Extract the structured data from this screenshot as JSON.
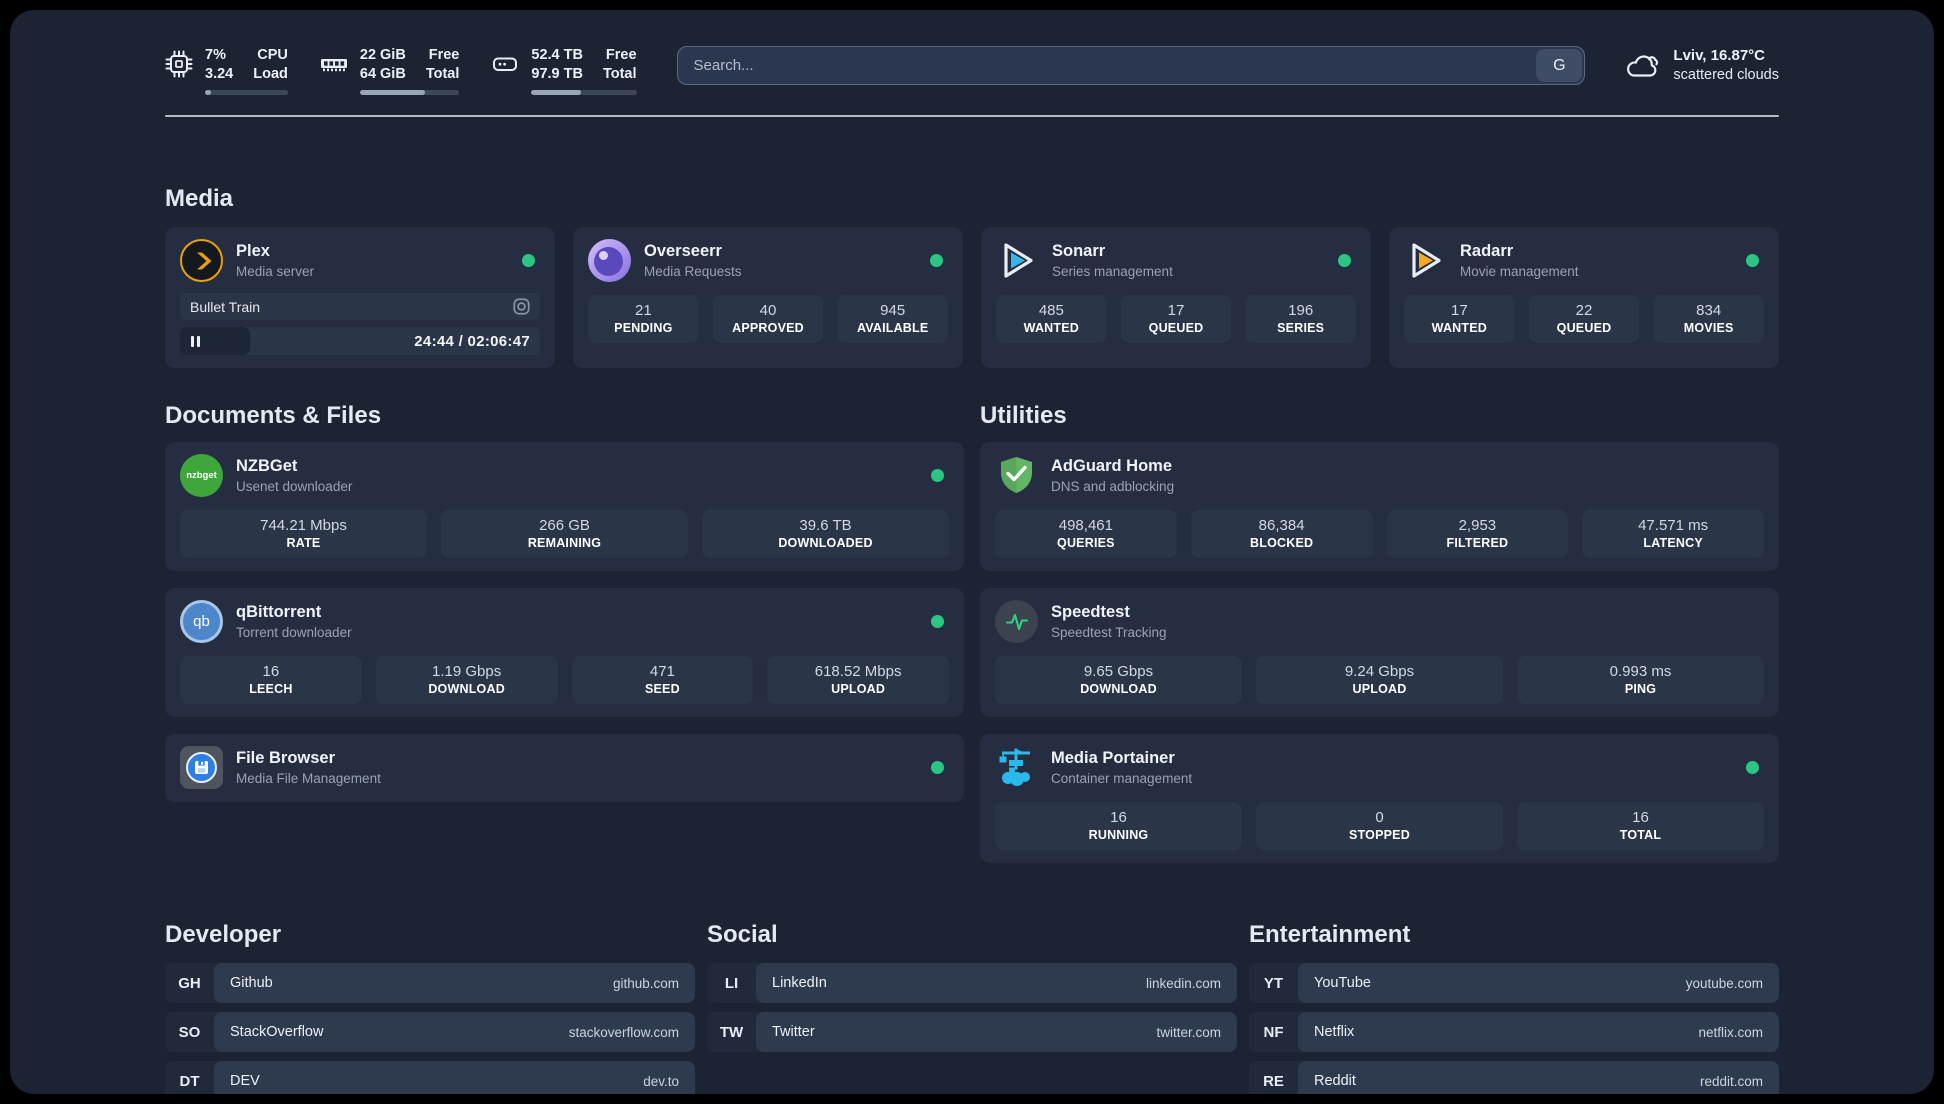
{
  "topbar": {
    "cpu": {
      "value1": "7%",
      "value2": "3.24",
      "label1": "CPU",
      "label2": "Load",
      "progress_pct": 7
    },
    "memory": {
      "value1": "22 GiB",
      "value2": "64 GiB",
      "label1": "Free",
      "label2": "Total",
      "progress_pct": 65
    },
    "disk": {
      "value1": "52.4 TB",
      "value2": "97.9 TB",
      "label1": "Free",
      "label2": "Total",
      "progress_pct": 47
    },
    "search": {
      "placeholder": "Search...",
      "engine_label": "G"
    },
    "weather": {
      "location": "Lviv, 16.87°C",
      "condition": "scattered clouds"
    }
  },
  "sections": {
    "media": "Media",
    "documents": "Documents & Files",
    "utilities": "Utilities",
    "developer": "Developer",
    "social": "Social",
    "entertainment": "Entertainment"
  },
  "apps": {
    "plex": {
      "name": "Plex",
      "desc": "Media server",
      "now_playing": {
        "title": "Bullet Train",
        "time": "24:44 / 02:06:47",
        "progress_pct": 19.5
      }
    },
    "overseerr": {
      "name": "Overseerr",
      "desc": "Media Requests",
      "stats": [
        {
          "value": "21",
          "label": "PENDING"
        },
        {
          "value": "40",
          "label": "APPROVED"
        },
        {
          "value": "945",
          "label": "AVAILABLE"
        }
      ]
    },
    "sonarr": {
      "name": "Sonarr",
      "desc": "Series management",
      "stats": [
        {
          "value": "485",
          "label": "WANTED"
        },
        {
          "value": "17",
          "label": "QUEUED"
        },
        {
          "value": "196",
          "label": "SERIES"
        }
      ]
    },
    "radarr": {
      "name": "Radarr",
      "desc": "Movie management",
      "stats": [
        {
          "value": "17",
          "label": "WANTED"
        },
        {
          "value": "22",
          "label": "QUEUED"
        },
        {
          "value": "834",
          "label": "MOVIES"
        }
      ]
    },
    "nzbget": {
      "name": "NZBGet",
      "desc": "Usenet downloader",
      "icon_text": "nzbget",
      "stats": [
        {
          "value": "744.21 Mbps",
          "label": "RATE"
        },
        {
          "value": "266 GB",
          "label": "REMAINING"
        },
        {
          "value": "39.6 TB",
          "label": "DOWNLOADED"
        }
      ]
    },
    "qbittorrent": {
      "name": "qBittorrent",
      "desc": "Torrent downloader",
      "icon_text": "qb",
      "stats": [
        {
          "value": "16",
          "label": "LEECH"
        },
        {
          "value": "1.19 Gbps",
          "label": "DOWNLOAD"
        },
        {
          "value": "471",
          "label": "SEED"
        },
        {
          "value": "618.52 Mbps",
          "label": "UPLOAD"
        }
      ]
    },
    "filebrowser": {
      "name": "File Browser",
      "desc": "Media File Management"
    },
    "adguard": {
      "name": "AdGuard Home",
      "desc": "DNS and adblocking",
      "stats": [
        {
          "value": "498,461",
          "label": "QUERIES"
        },
        {
          "value": "86,384",
          "label": "BLOCKED"
        },
        {
          "value": "2,953",
          "label": "FILTERED"
        },
        {
          "value": "47.571 ms",
          "label": "LATENCY"
        }
      ]
    },
    "speedtest": {
      "name": "Speedtest",
      "desc": "Speedtest Tracking",
      "stats": [
        {
          "value": "9.65 Gbps",
          "label": "DOWNLOAD"
        },
        {
          "value": "9.24 Gbps",
          "label": "UPLOAD"
        },
        {
          "value": "0.993 ms",
          "label": "PING"
        }
      ]
    },
    "portainer": {
      "name": "Media Portainer",
      "desc": "Container management",
      "stats": [
        {
          "value": "16",
          "label": "RUNNING"
        },
        {
          "value": "0",
          "label": "STOPPED"
        },
        {
          "value": "16",
          "label": "TOTAL"
        }
      ]
    }
  },
  "bookmarks": {
    "developer": [
      {
        "abbr": "GH",
        "name": "Github",
        "url": "github.com"
      },
      {
        "abbr": "SO",
        "name": "StackOverflow",
        "url": "stackoverflow.com"
      },
      {
        "abbr": "DT",
        "name": "DEV",
        "url": "dev.to"
      }
    ],
    "social": [
      {
        "abbr": "LI",
        "name": "LinkedIn",
        "url": "linkedin.com"
      },
      {
        "abbr": "TW",
        "name": "Twitter",
        "url": "twitter.com"
      }
    ],
    "entertainment": [
      {
        "abbr": "YT",
        "name": "YouTube",
        "url": "youtube.com"
      },
      {
        "abbr": "NF",
        "name": "Netflix",
        "url": "netflix.com"
      },
      {
        "abbr": "RE",
        "name": "Reddit",
        "url": "reddit.com"
      }
    ]
  },
  "colors": {
    "status_online": "#2cc584",
    "plex": "#e8a00d",
    "sonarr": "#36b6ea",
    "radarr": "#f7a823",
    "portainer": "#29b9ec",
    "adguard": "#63b663"
  }
}
